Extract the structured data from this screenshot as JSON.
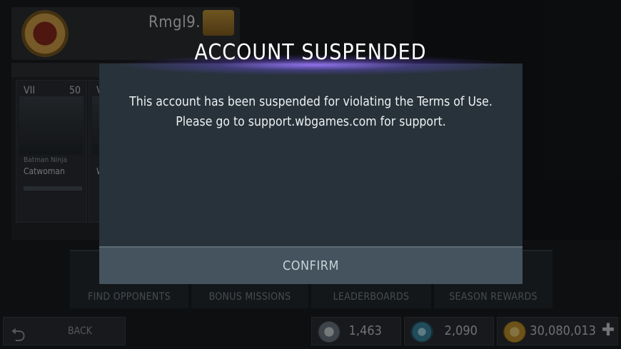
{
  "modal": {
    "title": "ACCOUNT SUSPENDED",
    "message": "This account has been suspended for violating the Terms of Use. Please go to support.wbgames.com for support.",
    "confirm_label": "CONFIRM"
  },
  "profile": {
    "player_name": "Rmgl9."
  },
  "roster": {
    "cards": [
      {
        "level": "VII",
        "rank": "50",
        "subtitle": "Batman Ninja",
        "name": "Catwoman"
      },
      {
        "level": "VI",
        "rank": "",
        "subtitle": "",
        "name": "W"
      }
    ]
  },
  "menu": {
    "items": [
      "FIND OPPONENTS",
      "BONUS MISSIONS",
      "LEADERBOARDS",
      "SEASON REWARDS"
    ]
  },
  "footer": {
    "back_label": "BACK",
    "currencies": [
      {
        "icon": "alliance-credit-icon",
        "amount": "1,463"
      },
      {
        "icon": "season-token-icon",
        "amount": "2,090"
      },
      {
        "icon": "gold-coin-icon",
        "amount": "30,080,013"
      }
    ],
    "add_label": "✚"
  },
  "colors": {
    "modal_bg": "#27323a",
    "confirm_bg": "#44535e",
    "title_glow": "#9b78ff"
  }
}
